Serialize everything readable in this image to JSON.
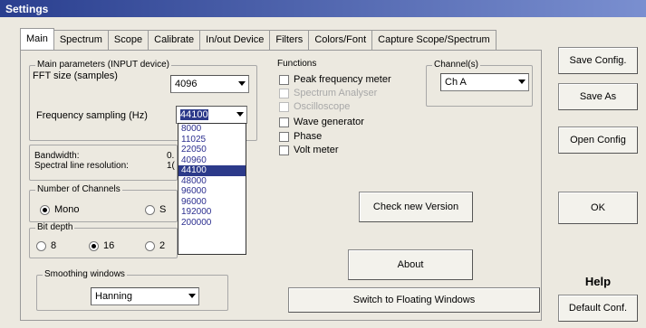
{
  "window": {
    "title": "Settings"
  },
  "tabs": [
    "Main",
    "Spectrum",
    "Scope",
    "Calibrate",
    "In/out Device",
    "Filters",
    "Colors/Font",
    "Capture Scope/Spectrum"
  ],
  "main_params": {
    "group_title": "Main parameters (INPUT device)",
    "fft_label": "FFT size (samples)",
    "fft_value": "4096",
    "freq_label": "Frequency sampling (Hz)",
    "freq_value": "44100",
    "freq_options": [
      "8000",
      "11025",
      "22050",
      "40960",
      "44100",
      "48000",
      "96000",
      "96000",
      "192000",
      "200000"
    ],
    "freq_selected_index": 4
  },
  "info": {
    "bandwidth_label": "Bandwidth:",
    "bandwidth_value": "0.",
    "resolution_label": "Spectral line resolution:",
    "resolution_value": "1("
  },
  "channels_group": {
    "title": "Number of Channels",
    "mono": "Mono",
    "stereo": "S"
  },
  "bit_depth": {
    "title": "Bit depth",
    "opt8": "8",
    "opt16": "16",
    "opt24": "2"
  },
  "smoothing": {
    "title": "Smoothing windows",
    "value": "Hanning"
  },
  "functions": {
    "title": "Functions",
    "items": [
      {
        "label": "Peak frequency meter",
        "enabled": true
      },
      {
        "label": "Spectrum Analyser",
        "enabled": false
      },
      {
        "label": "Oscilloscope",
        "enabled": false
      },
      {
        "label": "Wave generator",
        "enabled": true
      },
      {
        "label": "Phase",
        "enabled": true
      },
      {
        "label": "Volt meter",
        "enabled": true
      }
    ]
  },
  "channel_select": {
    "title": "Channel(s)",
    "value": "Ch A"
  },
  "buttons": {
    "check_version": "Check new Version",
    "about": "About",
    "floating": "Switch to Floating Windows",
    "save_config": "Save Config.",
    "save_as": "Save As",
    "open_config": "Open Config",
    "ok": "OK",
    "help": "Help",
    "default_conf": "Default Conf."
  }
}
